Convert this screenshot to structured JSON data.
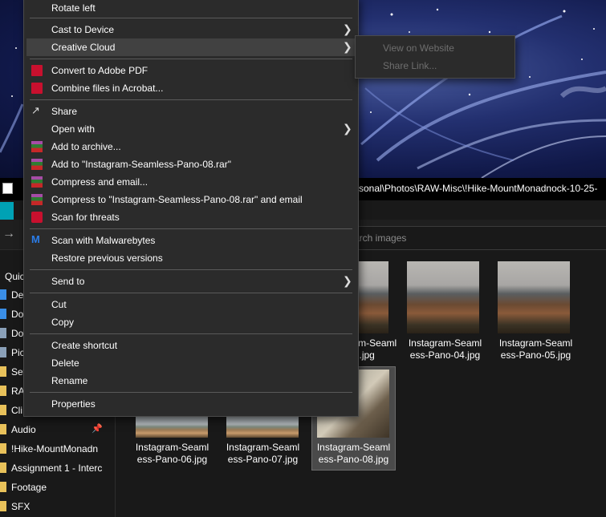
{
  "explorer": {
    "address_path": "sonal\\Photos\\RAW-Misc\\!Hike-MountMonadnock-10-25-",
    "search_placeholder": "arch images",
    "quick_access_label": "Quic",
    "nav_items": [
      {
        "label": "De",
        "color": "#3a8ee6"
      },
      {
        "label": "Do",
        "color": "#3a8ee6"
      },
      {
        "label": "Do",
        "color": "#8aa0b8"
      },
      {
        "label": "Pic",
        "color": "#8aa0b8"
      },
      {
        "label": "Set",
        "color": "#e8c15a"
      },
      {
        "label": "RA",
        "color": "#e8c15a"
      },
      {
        "label": "Cli",
        "color": "#e8c15a"
      },
      {
        "label": "Audio",
        "color": "#e8c15a"
      },
      {
        "label": "!Hike-MountMonadn",
        "color": "#e8c15a"
      },
      {
        "label": "Assignment 1 - Interc",
        "color": "#e8c15a"
      },
      {
        "label": "Footage",
        "color": "#e8c15a"
      },
      {
        "label": "SFX",
        "color": "#e8c15a"
      }
    ],
    "files": [
      {
        "name": "Instagram-Seaml ess-Pano-03.jpg",
        "line1": "Instagram-Seaml",
        "line2": "-03.jpg"
      },
      {
        "name": "Instagram-Seaml ess-Pano-04.jpg",
        "line1": "Instagram-Seaml",
        "line2": "ess-Pano-04.jpg"
      },
      {
        "name": "Instagram-Seaml ess-Pano-05.jpg",
        "line1": "Instagram-Seaml",
        "line2": "ess-Pano-05.jpg"
      },
      {
        "name": "Instagram-Seaml ess-Pano-06.jpg",
        "line1": "Instagram-Seaml",
        "line2": "ess-Pano-06.jpg"
      },
      {
        "name": "Instagram-Seaml ess-Pano-07.jpg",
        "line1": "Instagram-Seaml",
        "line2": "ess-Pano-07.jpg"
      },
      {
        "name": "Instagram-Seaml ess-Pano-08.jpg",
        "line1": "Instagram-Seaml",
        "line2": "ess-Pano-08.jpg"
      }
    ]
  },
  "context_menu": {
    "items": [
      {
        "label": "Rotate left"
      },
      {
        "label": "Cast to Device"
      },
      {
        "label": "Creative Cloud"
      },
      {
        "label": "Convert to Adobe PDF"
      },
      {
        "label": "Combine files in Acrobat..."
      },
      {
        "label": "Share"
      },
      {
        "label": "Open with"
      },
      {
        "label": "Add to archive..."
      },
      {
        "label": "Add to \"Instagram-Seamless-Pano-08.rar\""
      },
      {
        "label": "Compress and email..."
      },
      {
        "label": "Compress to \"Instagram-Seamless-Pano-08.rar\" and email"
      },
      {
        "label": "Scan for threats"
      },
      {
        "label": "Scan with Malwarebytes"
      },
      {
        "label": "Restore previous versions"
      },
      {
        "label": "Send to"
      },
      {
        "label": "Cut"
      },
      {
        "label": "Copy"
      },
      {
        "label": "Create shortcut"
      },
      {
        "label": "Delete"
      },
      {
        "label": "Rename"
      },
      {
        "label": "Properties"
      }
    ],
    "submenu": {
      "items": [
        {
          "label": "View on Website"
        },
        {
          "label": "Share Link..."
        }
      ]
    }
  }
}
